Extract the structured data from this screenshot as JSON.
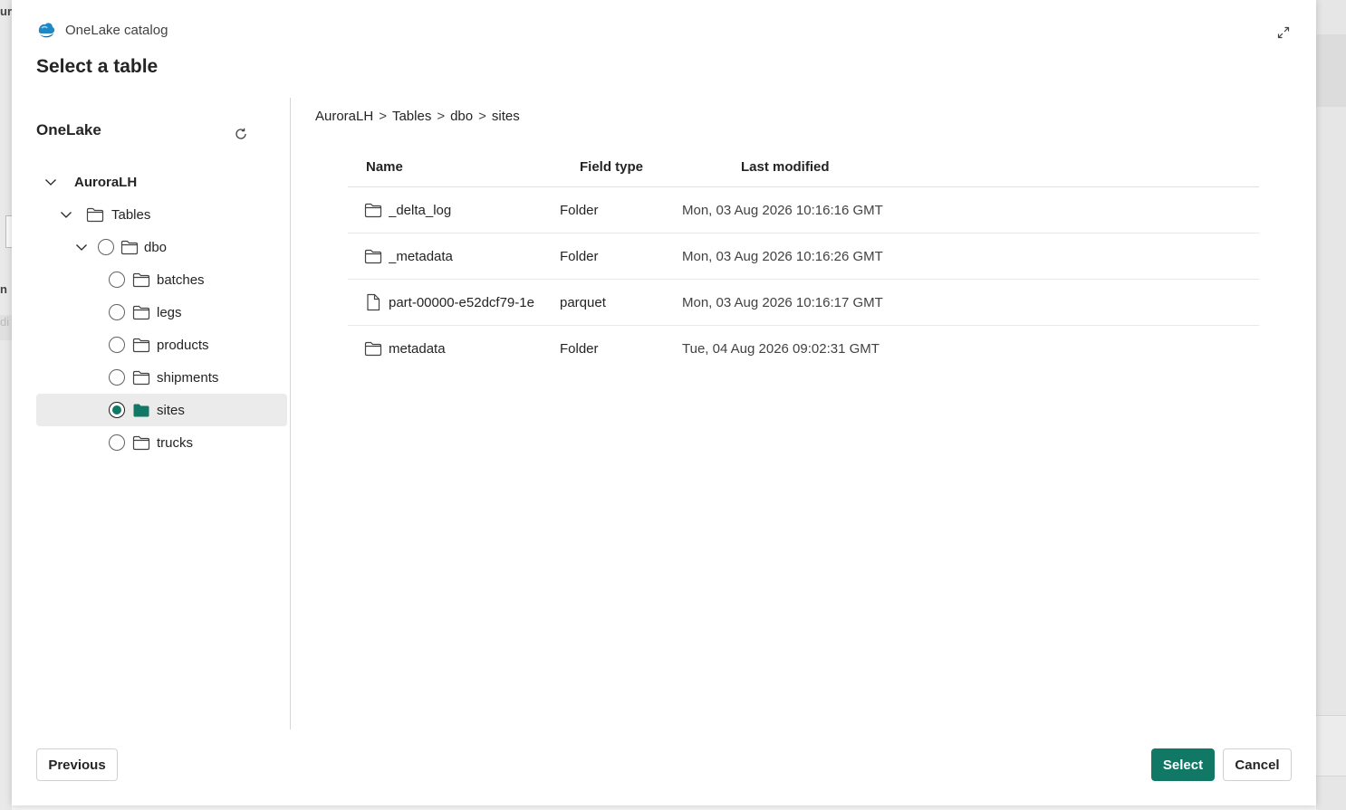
{
  "background": {
    "edge_glyphs": [
      "ur",
      "n",
      "di"
    ]
  },
  "dialog": {
    "brand": "OneLake catalog",
    "title": "Select a table",
    "accent_color": "#117865"
  },
  "left_pane": {
    "title": "OneLake",
    "tree": [
      {
        "label": "AuroraLH",
        "icon": "none",
        "radio": false,
        "expanded": true
      },
      {
        "label": "Tables",
        "icon": "folder-icon",
        "radio": false,
        "expanded": true
      },
      {
        "label": "dbo",
        "icon": "folder-icon",
        "radio": true,
        "checked": false,
        "expanded": true
      },
      {
        "label": "batches",
        "icon": "folder-icon",
        "radio": true,
        "checked": false
      },
      {
        "label": "legs",
        "icon": "folder-icon",
        "radio": true,
        "checked": false
      },
      {
        "label": "products",
        "icon": "folder-icon",
        "radio": true,
        "checked": false
      },
      {
        "label": "shipments",
        "icon": "folder-icon",
        "radio": true,
        "checked": false
      },
      {
        "label": "sites",
        "icon": "folder-filled-icon",
        "radio": true,
        "checked": true,
        "selected": true
      },
      {
        "label": "trucks",
        "icon": "folder-icon",
        "radio": true,
        "checked": false
      }
    ]
  },
  "breadcrumb": [
    "AuroraLH",
    "Tables",
    "dbo",
    "sites"
  ],
  "breadcrumb_sep": ">",
  "table": {
    "columns": [
      "Name",
      "Field type",
      "Last modified"
    ],
    "rows": [
      {
        "name": "_delta_log",
        "type": "Folder",
        "modified": "Mon, 03 Aug 2026 10:16:16 GMT",
        "icon": "folder-icon"
      },
      {
        "name": "_metadata",
        "type": "Folder",
        "modified": "Mon, 03 Aug 2026 10:16:26 GMT",
        "icon": "folder-icon"
      },
      {
        "name": "part-00000-e52dcf79-1e",
        "type": "parquet",
        "modified": "Mon, 03 Aug 2026 10:16:17 GMT",
        "icon": "file-icon"
      },
      {
        "name": "metadata",
        "type": "Folder",
        "modified": "Tue, 04 Aug 2026 09:02:31 GMT",
        "icon": "folder-icon"
      }
    ]
  },
  "footer": {
    "previous_label": "Previous",
    "select_label": "Select",
    "cancel_label": "Cancel"
  }
}
